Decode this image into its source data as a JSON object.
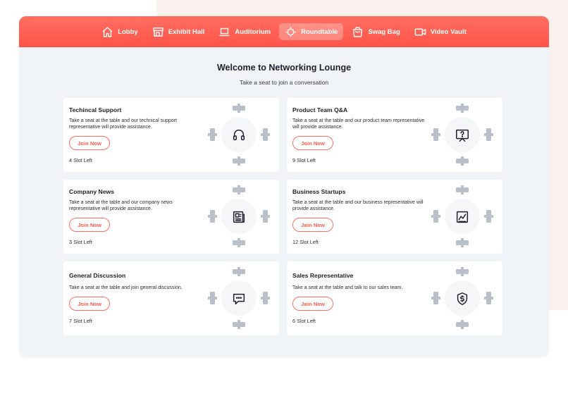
{
  "nav": [
    {
      "label": "Lobby",
      "icon": "home-icon",
      "active": false
    },
    {
      "label": "Exhibit Hall",
      "icon": "storefront-icon",
      "active": false
    },
    {
      "label": "Auditorium",
      "icon": "laptop-icon",
      "active": false
    },
    {
      "label": "Roundtable",
      "icon": "roundtable-icon",
      "active": true
    },
    {
      "label": "Swag Bag",
      "icon": "bag-icon",
      "active": false
    },
    {
      "label": "Video Vault",
      "icon": "video-icon",
      "active": false
    }
  ],
  "page": {
    "title": "Welcome to Networking Lounge",
    "subtitle": "Take a seat to join a conversation"
  },
  "rooms": [
    {
      "name": "Techincal Support",
      "desc": "Take a seat at the table and our technical support representative will provide assistance.",
      "join": "Join Now",
      "slots": "4 Slot Left",
      "icon": "headphones-icon"
    },
    {
      "name": "Product Team Q&A",
      "desc": "Take a seat at the table and our product team representative will provide assistance.",
      "join": "Join Now",
      "slots": "9 Slot Left",
      "icon": "question-board-icon"
    },
    {
      "name": "Company News",
      "desc": "Take a seat at the table and our company news representative will provide assistance.",
      "join": "Join Now",
      "slots": "3 Slot Left",
      "icon": "newspaper-icon"
    },
    {
      "name": "Business Startups",
      "desc": "Take a seat at the table and our business representative will provide assistance.",
      "join": "Join Now",
      "slots": "12 Slot Left",
      "icon": "chart-icon"
    },
    {
      "name": "General Discussion",
      "desc": "Take a seat at the table and join general discussion.",
      "join": "Join Now",
      "slots": "7 Slot Left",
      "icon": "chat-icon"
    },
    {
      "name": "Sales Representative",
      "desc": "Take a seat at the table and talk to our sales team.",
      "join": "Join Now",
      "slots": "6 Slot Left",
      "icon": "dollar-shield-icon"
    }
  ],
  "colors": {
    "accent": "#ff5a4e",
    "header_top": "#ff6f61",
    "chair": "#b9c0c9",
    "background": "#f1f4f7"
  }
}
